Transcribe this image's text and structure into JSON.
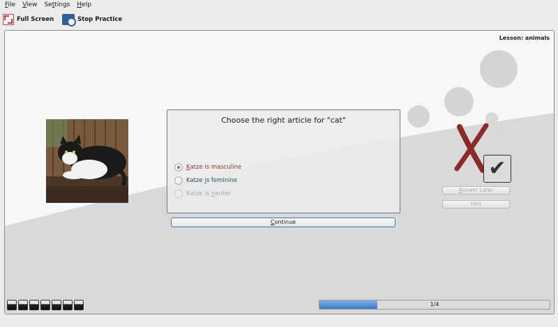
{
  "menu": {
    "file": {
      "u": "F",
      "rest": "ile"
    },
    "view": {
      "u": "V",
      "rest": "iew"
    },
    "settings": {
      "pre": "Se",
      "u": "t",
      "rest": "tings"
    },
    "help": {
      "u": "H",
      "rest": "elp"
    }
  },
  "toolbar": {
    "full_screen": "Full Screen",
    "stop_practice": "Stop Practice"
  },
  "lesson": "Lesson: animals",
  "question": "Choose the right article for \"cat\"",
  "options": [
    {
      "pre": "",
      "u": "K",
      "rest": "atze is masculine",
      "state": "checked"
    },
    {
      "pre": "Katze ",
      "u": "i",
      "rest": "s feminine",
      "state": "normal"
    },
    {
      "pre": "Katze is ",
      "u": "n",
      "rest": "euter",
      "state": "disabled"
    }
  ],
  "continue": {
    "u": "C",
    "rest": "ontinue"
  },
  "answer_later": {
    "u": "A",
    "rest": "nswer Later"
  },
  "hint": "Hint",
  "checkmark": "✔",
  "progress": {
    "text": "1/4",
    "fraction": 0.25
  },
  "colors": {
    "accent": "#3a7cc8",
    "wrong_mark": "#8b2a27",
    "correct_option": "#9b3530"
  }
}
